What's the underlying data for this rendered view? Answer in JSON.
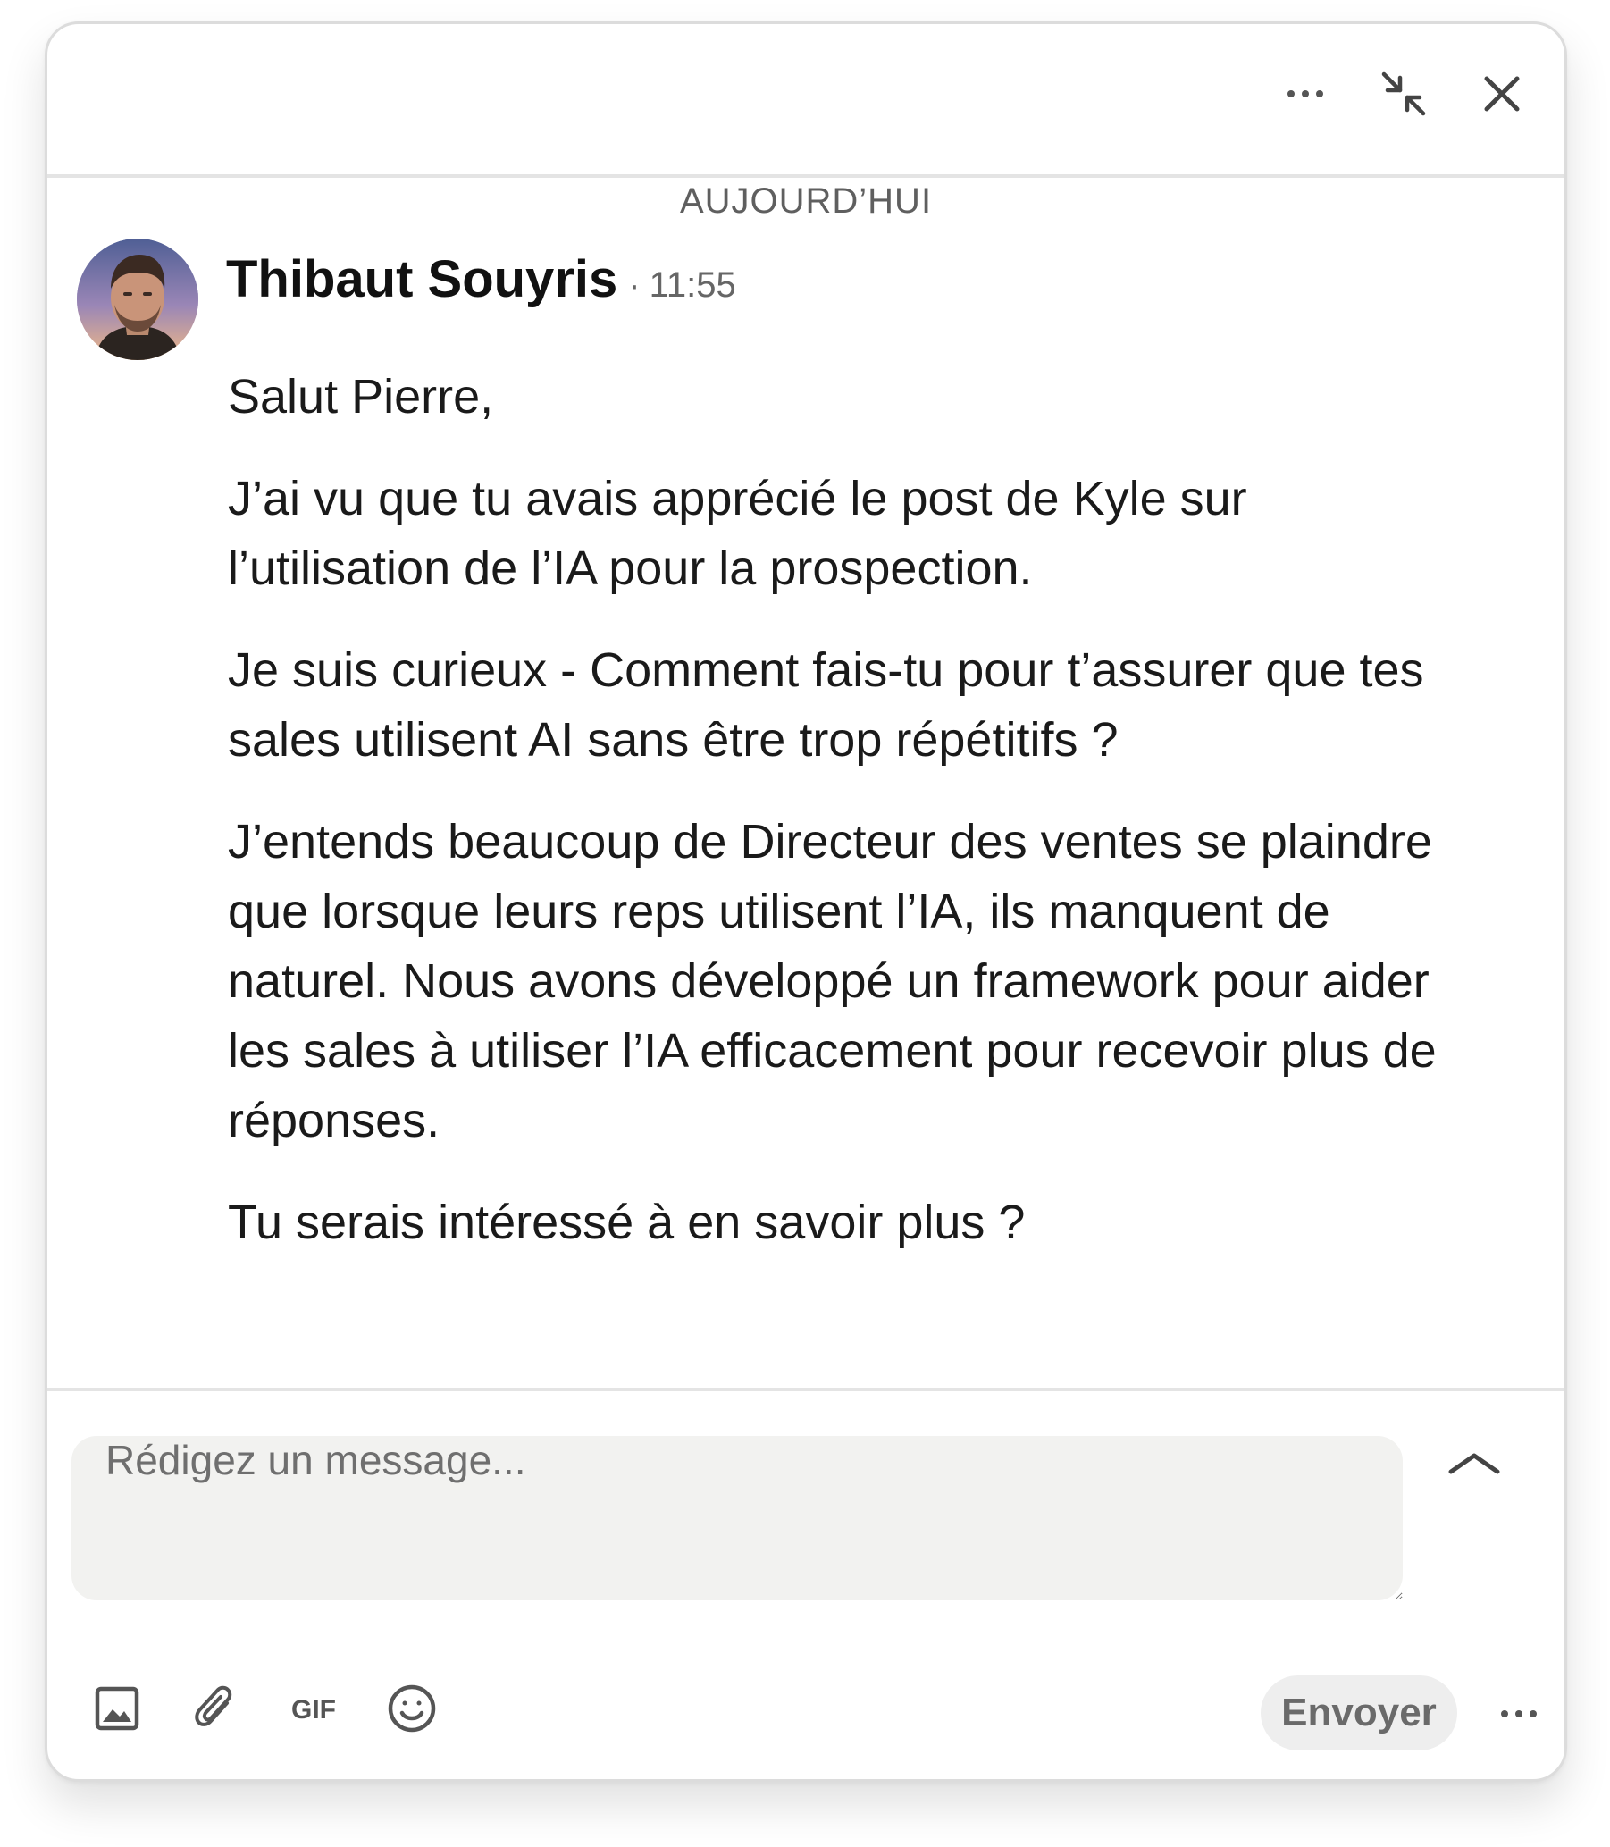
{
  "header": {
    "more_icon": "more-horizontal-icon",
    "minimize_icon": "minimize-arrows-icon",
    "close_icon": "close-icon"
  },
  "conversation": {
    "date_label": "AUJOURD’HUI",
    "message": {
      "sender_name": "Thibaut Souyris",
      "separator": "·",
      "time": "11:55",
      "paragraphs": [
        "Salut Pierre,",
        "J’ai vu que tu avais apprécié le post de Kyle sur l’utilisation de l’IA pour la prospection.",
        "Je suis curieux - Comment fais-tu pour t’assurer que tes sales utilisent AI sans être trop répétitifs ?",
        "J’entends beaucoup de Directeur des ventes se plaindre que lorsque leurs reps utilisent l’IA, ils manquent de naturel. Nous avons développé un framework pour aider les sales à utiliser l’IA efficacement pour recevoir plus de réponses.",
        "Tu serais intéressé à en savoir plus ?"
      ]
    }
  },
  "composer": {
    "placeholder": "Rédigez un message...",
    "value": "",
    "expand_icon": "chevron-up-icon",
    "toolbar": {
      "image_icon": "image-icon",
      "attach_icon": "paperclip-icon",
      "gif_label": "GIF",
      "emoji_icon": "emoji-icon"
    },
    "send_label": "Envoyer",
    "more_icon": "more-horizontal-icon"
  },
  "colors": {
    "border": "#dcdcdc",
    "divider": "#e4e4e4",
    "input_bg": "#f2f2f0",
    "send_bg": "#eeeeee",
    "text": "#1a1a1a",
    "muted": "#666666",
    "icon": "#5f5f5f"
  }
}
